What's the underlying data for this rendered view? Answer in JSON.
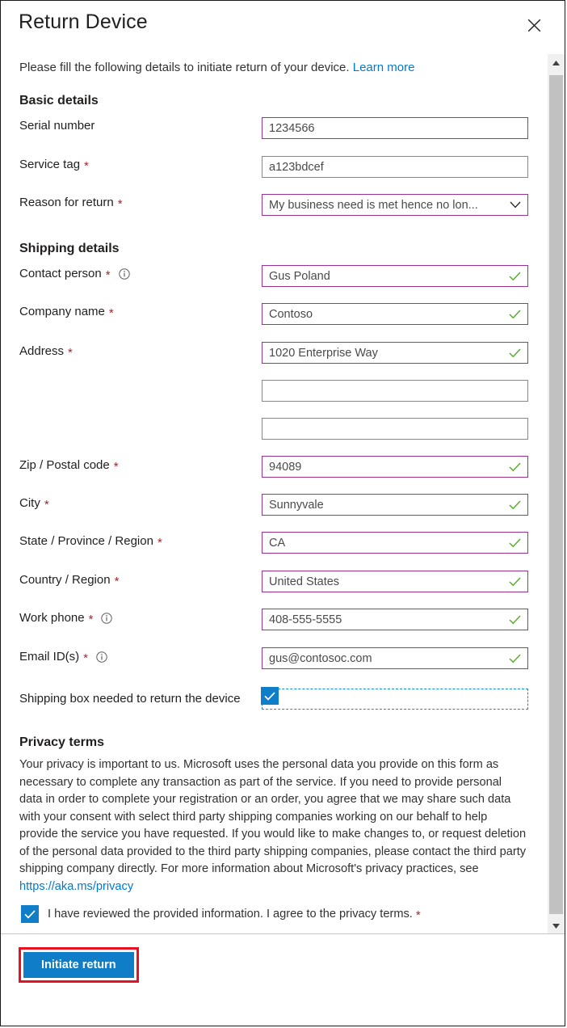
{
  "dialog": {
    "title": "Return Device",
    "close_icon": "close-icon",
    "intro_text": "Please fill the following details to initiate return of your device.",
    "intro_link": "Learn more"
  },
  "basic_details": {
    "section_title": "Basic details",
    "fields": [
      {
        "label": "Serial number",
        "required": false,
        "info": false,
        "value": "1234566",
        "state": "filled",
        "valid": false,
        "type": "text"
      },
      {
        "label": "Service tag",
        "required": true,
        "info": false,
        "value": "a123bdcef",
        "state": "default",
        "valid": false,
        "type": "text"
      },
      {
        "label": "Reason for return",
        "required": true,
        "info": false,
        "value": "My business need is met hence no lon...",
        "state": "filled",
        "valid": false,
        "type": "select"
      }
    ]
  },
  "shipping_details": {
    "section_title": "Shipping details",
    "fields": [
      {
        "label": "Contact person",
        "required": true,
        "info": true,
        "value": "Gus Poland",
        "state": "filled",
        "valid": true,
        "type": "text"
      },
      {
        "label": "Company name",
        "required": true,
        "info": false,
        "value": "Contoso",
        "state": "filled",
        "valid": true,
        "type": "text"
      },
      {
        "label": "Address",
        "required": true,
        "info": false,
        "value": "1020 Enterprise Way",
        "state": "filled",
        "valid": true,
        "type": "text"
      },
      {
        "label": "",
        "required": false,
        "info": false,
        "value": "",
        "state": "default",
        "valid": false,
        "type": "text"
      },
      {
        "label": "",
        "required": false,
        "info": false,
        "value": "",
        "state": "default",
        "valid": false,
        "type": "text"
      },
      {
        "label": "Zip / Postal code",
        "required": true,
        "info": false,
        "value": "94089",
        "state": "filled",
        "valid": true,
        "type": "text"
      },
      {
        "label": "City",
        "required": true,
        "info": false,
        "value": "Sunnyvale",
        "state": "filled",
        "valid": true,
        "type": "text"
      },
      {
        "label": "State / Province / Region",
        "required": true,
        "info": false,
        "value": "CA",
        "state": "filled",
        "valid": true,
        "type": "text"
      },
      {
        "label": "Country / Region",
        "required": true,
        "info": false,
        "value": "United States",
        "state": "filled",
        "valid": true,
        "type": "text"
      },
      {
        "label": "Work phone",
        "required": true,
        "info": true,
        "value": "408-555-5555",
        "state": "filled",
        "valid": true,
        "type": "text"
      },
      {
        "label": "Email ID(s)",
        "required": true,
        "info": true,
        "value": "gus@contosoc.com",
        "state": "filled",
        "valid": true,
        "type": "text"
      }
    ],
    "shipping_box": {
      "label": "Shipping box needed to return the device",
      "checked": true
    }
  },
  "privacy": {
    "title": "Privacy terms",
    "body": "Your privacy is important to us. Microsoft uses the personal data you provide on this form as necessary to complete any transaction as part of the service. If you need to provide personal data in order to complete your registration or an order, you agree that we may share such data with your consent with select third party shipping companies working on our behalf to help provide the service you have requested. If you would like to make changes to, or request deletion of the personal data provided to the third party shipping companies, please contact the third party shipping company directly. For more information about Microsoft's privacy practices, see ",
    "link": "https://aka.ms/privacy",
    "consent_label": "I have reviewed the provided information. I agree to the privacy terms.",
    "consent_checked": true,
    "consent_required": true
  },
  "footer": {
    "primary_button": "Initiate return"
  },
  "scrollbar": {
    "up_icon": "caret-up-icon",
    "down_icon": "caret-down-icon"
  },
  "colors": {
    "accent": "#0078d4",
    "link": "#0078d4",
    "required": "#a4262c",
    "valid_check": "#4caf21",
    "field_active_border": "#993399",
    "field_border": "#8a8886",
    "highlight": "#e81123"
  }
}
